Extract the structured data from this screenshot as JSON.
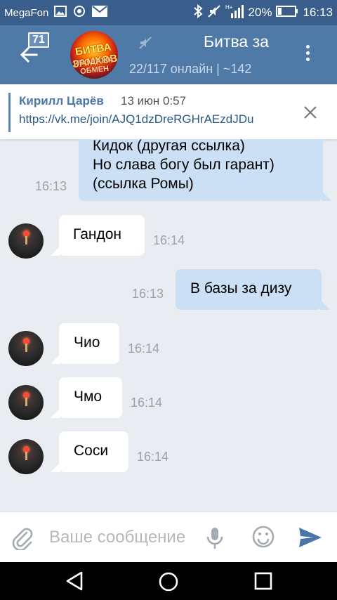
{
  "status_bar": {
    "carrier": "MegaFon",
    "battery": "20%",
    "time": "16:13",
    "network": "H+"
  },
  "header": {
    "unread_badge": "71",
    "title": "Битва за",
    "subtitle": "22/117 онлайн | ~142",
    "avatar_text_line1": "БИТВА ЗАМКОВ",
    "avatar_text_line2": "ПРОДАЖА ОБМЕН"
  },
  "pinned": {
    "author": "Кирилл Царёв",
    "date": "13 июн 0:57",
    "link": "https://vk.me/join/AJQ1dzDreRGHrAEzdJDu"
  },
  "messages": [
    {
      "direction": "out",
      "lines": [
        "Кидок (другая ссылка)",
        "Но слава богу был гарант)",
        "(ссылка Ромы)"
      ],
      "time": "16:13"
    },
    {
      "direction": "in",
      "text": "Гандон",
      "time": "16:14"
    },
    {
      "direction": "out",
      "text": "В базы за дизу",
      "time": "16:13"
    },
    {
      "direction": "in",
      "text": "Чио",
      "time": "16:14"
    },
    {
      "direction": "in",
      "text": "Чмо",
      "time": "16:14"
    },
    {
      "direction": "in",
      "text": "Соси",
      "time": "16:14"
    }
  ],
  "input": {
    "placeholder": "Ваше сообщение"
  },
  "colors": {
    "header": "#4f79a6",
    "status_bar": "#3a5e8c",
    "outgoing_bubble": "#cce0f5",
    "incoming_bubble": "#ffffff",
    "chat_background": "#e9ecf1",
    "send_icon": "#4a76a8"
  }
}
